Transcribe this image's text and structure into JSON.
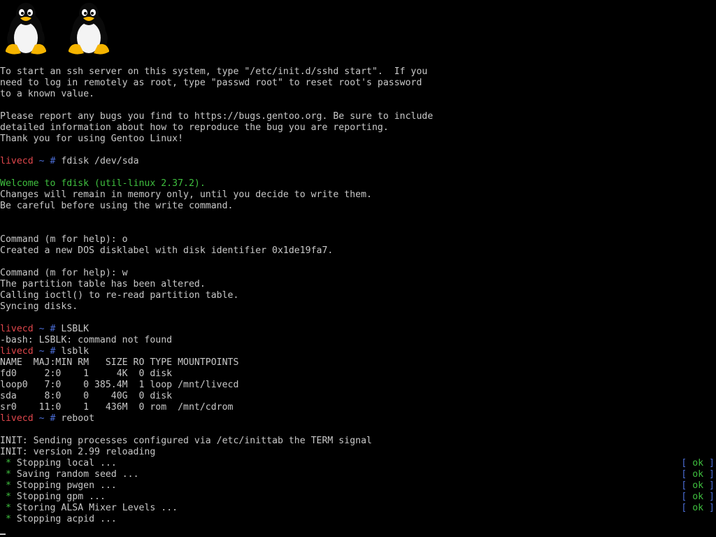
{
  "logo": {
    "penguin_count": 2,
    "icon": "tux-penguin-icon"
  },
  "colors": {
    "background": "#000000",
    "text": "#c8c8c8",
    "prompt_user": "#e0474c",
    "prompt_path": "#4a6cd4",
    "success": "#3fbf3f"
  },
  "prompt": {
    "host": "livecd",
    "path": "~",
    "symbol": "#"
  },
  "intro": [
    "To start an ssh server on this system, type \"/etc/init.d/sshd start\".  If you",
    "need to log in remotely as root, type \"passwd root\" to reset root's password",
    "to a known value.",
    "",
    "Please report any bugs you find to https://bugs.gentoo.org. Be sure to include",
    "detailed information about how to reproduce the bug you are reporting.",
    "Thank you for using Gentoo Linux!"
  ],
  "commands": {
    "fdisk": "fdisk /dev/sda",
    "lsblk_upper": "LSBLK",
    "lsblk": "lsblk",
    "reboot": "reboot"
  },
  "fdisk_output": {
    "welcome": "Welcome to fdisk (util-linux 2.37.2).",
    "lines": [
      "Changes will remain in memory only, until you decide to write them.",
      "Be careful before using the write command."
    ],
    "session": [
      "Command (m for help): o",
      "Created a new DOS disklabel with disk identifier 0x1de19fa7.",
      "",
      "Command (m for help): w",
      "The partition table has been altered.",
      "Calling ioctl() to re-read partition table.",
      "Syncing disks."
    ]
  },
  "lsblk_error": "-bash: LSBLK: command not found",
  "lsblk_table": {
    "header": "NAME  MAJ:MIN RM   SIZE RO TYPE MOUNTPOINTS",
    "rows": [
      "fd0     2:0    1     4K  0 disk",
      "loop0   7:0    0 385.4M  1 loop /mnt/livecd",
      "sda     8:0    0    40G  0 disk",
      "sr0    11:0    1   436M  0 rom  /mnt/cdrom"
    ]
  },
  "init": [
    "INIT: Sending processes configured via /etc/inittab the TERM signal",
    "INIT: version 2.99 reloading"
  ],
  "services": {
    "bullet": "*",
    "status_open": "[",
    "status_ok": "ok",
    "status_close": "]",
    "items": [
      {
        "text": "Stopping local ...",
        "done": true
      },
      {
        "text": "Saving random seed ...",
        "done": true
      },
      {
        "text": "Stopping pwgen ...",
        "done": true
      },
      {
        "text": "Stopping gpm ...",
        "done": true
      },
      {
        "text": "Storing ALSA Mixer Levels ...",
        "done": true
      },
      {
        "text": "Stopping acpid ...",
        "done": false
      }
    ]
  }
}
